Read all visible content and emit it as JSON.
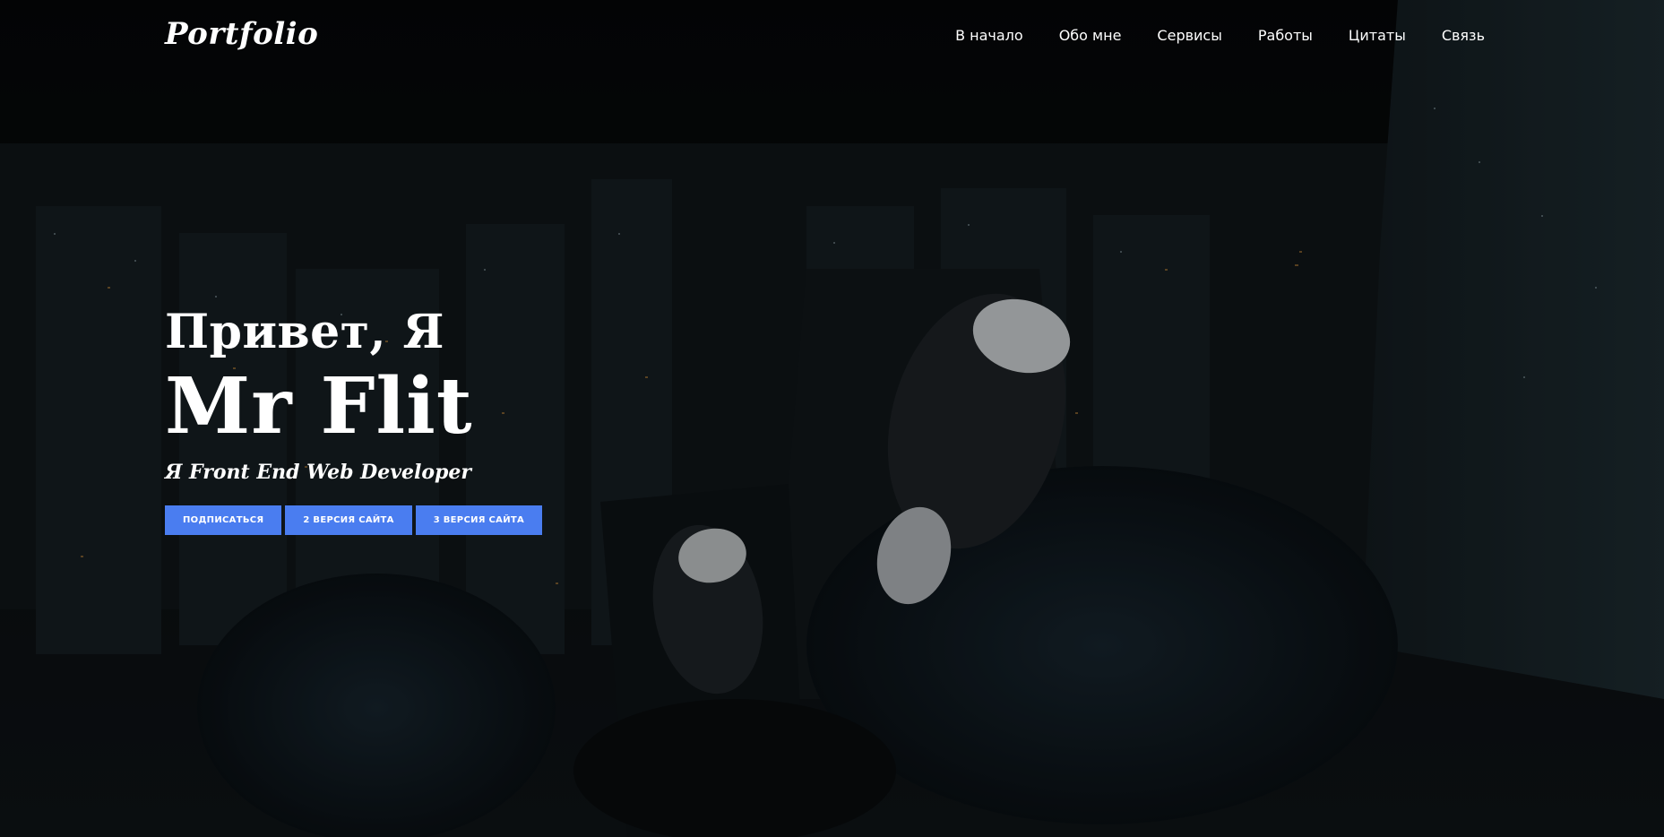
{
  "navbar": {
    "logo": "Portfolio",
    "links": [
      "В начало",
      "Обо мне",
      "Сервисы",
      "Работы",
      "Цитаты",
      "Связь"
    ]
  },
  "hero": {
    "greeting": "Привет, Я",
    "name": "Mr Flit",
    "role": "Я Front End Web Developer",
    "buttons": [
      "ПОДПИСАТЬСЯ",
      "2 ВЕРСИЯ САЙТА",
      "3 ВЕРСИЯ САЙТА"
    ],
    "background_image": "night-city-sneakers-photo"
  },
  "colors": {
    "button_bg": "#4a7df0",
    "text": "#ffffff",
    "background": "#050607"
  }
}
